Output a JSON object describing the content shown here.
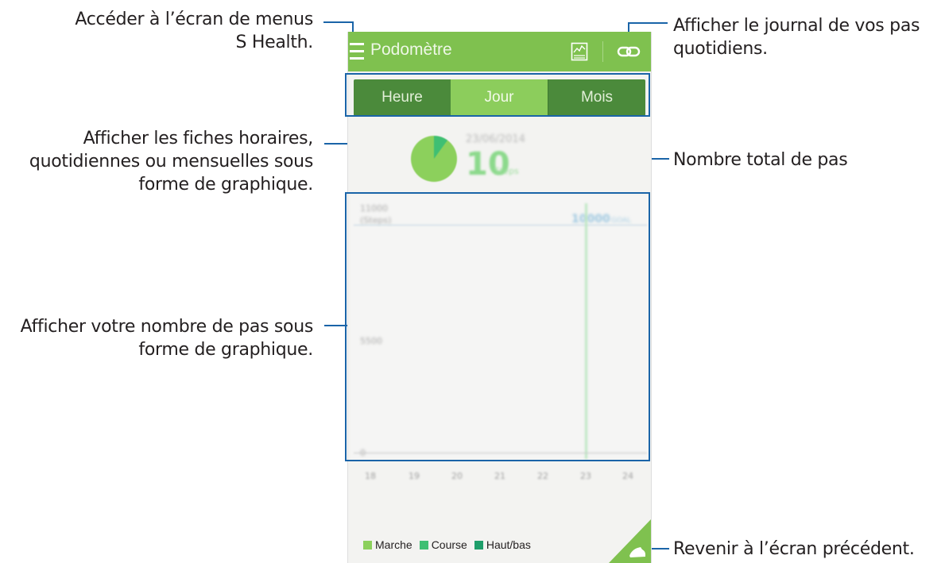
{
  "annotations": {
    "menu": [
      "Accéder à l’écran de menus",
      "S Health."
    ],
    "tabs": [
      "Afficher les fiches horaires,",
      "quotidiennes ou mensuelles sous",
      "forme de graphique."
    ],
    "graph": [
      "Afficher votre nombre de pas sous",
      "forme de graphique."
    ],
    "log": [
      "Afficher le journal de vos pas",
      "quotidiens."
    ],
    "total": [
      "Nombre total de pas"
    ],
    "back": [
      "Revenir à l’écran précédent."
    ]
  },
  "app": {
    "title": "Podomètre",
    "icons": {
      "menu": "hamburger-menu-icon",
      "chart": "chart-log-icon",
      "link": "link-icon",
      "back": "shoe-icon"
    }
  },
  "tabs": [
    {
      "label": "Heure",
      "active": false
    },
    {
      "label": "Jour",
      "active": true
    },
    {
      "label": "Mois",
      "active": false
    }
  ],
  "summary": {
    "date": "23/06/2014",
    "steps": "10",
    "unit": "Steps",
    "progress": 0.1
  },
  "graph": {
    "y_ticks": [
      "11000",
      "(Steps)",
      "5500",
      "0"
    ],
    "goal_value": "10000",
    "goal_unit": "GOAL",
    "x_ticks": [
      "18",
      "19",
      "20",
      "21",
      "22",
      "23",
      "24"
    ]
  },
  "legend": [
    {
      "label": "Marche",
      "color": "#8cd05c"
    },
    {
      "label": "Course",
      "color": "#3fbf73"
    },
    {
      "label": "Haut/bas",
      "color": "#1e9e6a"
    }
  ],
  "colors": {
    "accent": "#7fc14f",
    "tab_dark": "#4b8a3b",
    "tab_active": "#8ccd5c",
    "highlight": "#1a64a8"
  }
}
